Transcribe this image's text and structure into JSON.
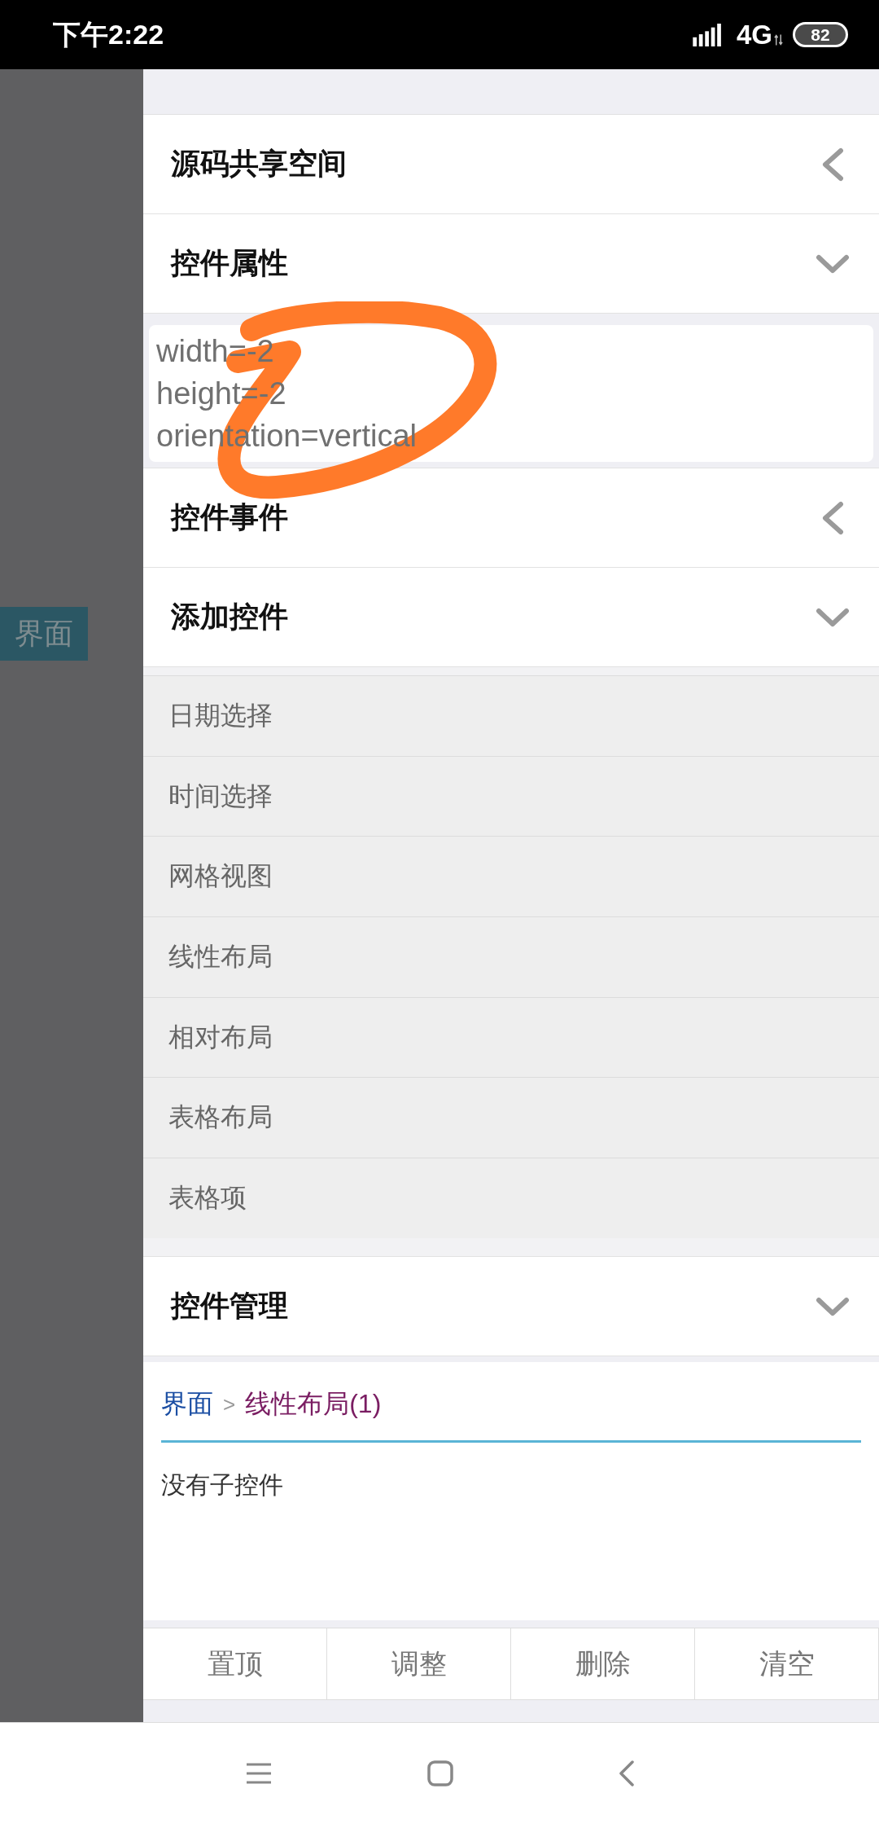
{
  "status_bar": {
    "time": "下午2:22",
    "network": "4G",
    "battery": "82"
  },
  "sidebar": {
    "tab": "界面"
  },
  "panels": [
    {
      "title": "源码共享空间",
      "expanded": false
    },
    {
      "title": "控件属性",
      "expanded": true,
      "kind": "properties",
      "lines": [
        "width=-2",
        "height=-2",
        "orientation=vertical"
      ]
    },
    {
      "title": "控件事件",
      "expanded": false
    },
    {
      "title": "添加控件",
      "expanded": true,
      "kind": "list",
      "items": [
        "日期选择",
        "时间选择",
        "网格视图",
        "线性布局",
        "相对布局",
        "表格布局",
        "表格项"
      ]
    },
    {
      "title": "控件管理",
      "expanded": true,
      "kind": "manager",
      "breadcrumb": [
        {
          "label": "界面",
          "color": "#1b4ea3"
        },
        {
          "label": "线性布局(1)",
          "color": "#7a1d62"
        }
      ],
      "separator": ">",
      "empty_text": "没有子控件",
      "buttons": [
        "置顶",
        "调整",
        "删除",
        "清空"
      ]
    }
  ]
}
